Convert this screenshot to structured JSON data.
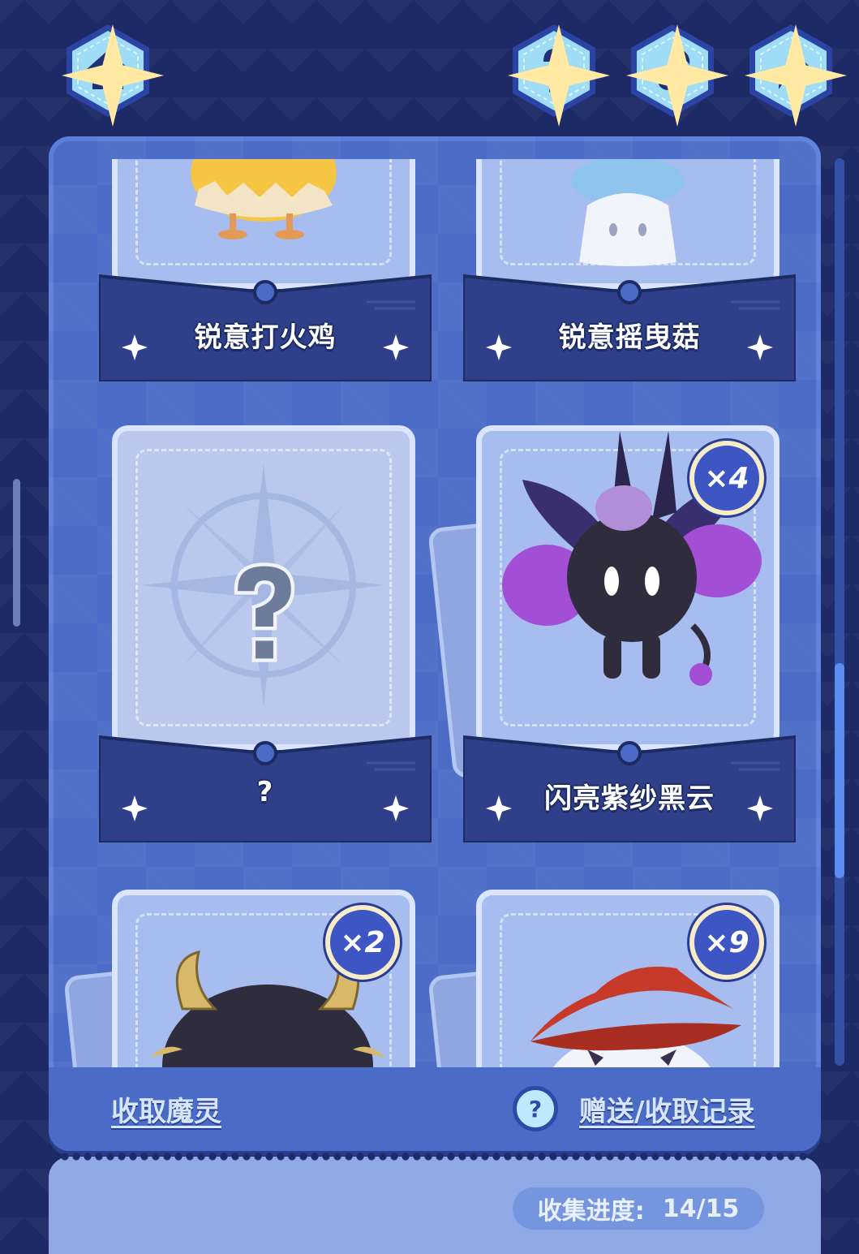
{
  "top_nav": {
    "home": {
      "icon": "home-icon"
    },
    "help": {
      "icon": "question-icon"
    },
    "music": {
      "icon": "music-note-icon"
    },
    "share": {
      "icon": "share-arrow-icon"
    }
  },
  "colors": {
    "background": "#1e2a66",
    "panel": "#4a6cc6",
    "pocket": "#2f3f8a",
    "card": "#a7bdf0",
    "hex_button": "#9fdcf6",
    "accent_link": "#d6e6ff"
  },
  "cards": [
    {
      "name": "锐意打火鸡",
      "count": null,
      "creature": "fire-chick-icon",
      "locked": false
    },
    {
      "name": "锐意摇曳菇",
      "count": null,
      "creature": "ghost-mushroom-icon",
      "locked": false
    },
    {
      "name": "?",
      "count": null,
      "creature": "locked-question-icon",
      "locked": true
    },
    {
      "name": "闪亮紫纱黑云",
      "count": "×4",
      "creature": "dark-cloud-creature-icon",
      "locked": false
    },
    {
      "name": "",
      "count": "×2",
      "creature": "horned-creature-icon",
      "locked": false
    },
    {
      "name": "",
      "count": "×9",
      "creature": "wizard-hat-creature-icon",
      "locked": false
    }
  ],
  "footer": {
    "collect_link": "收取魔灵",
    "history_link": "赠送/收取记录",
    "help_icon": "?"
  },
  "progress": {
    "label": "收集进度:",
    "value": "14/15",
    "collected": 14,
    "total": 15
  }
}
